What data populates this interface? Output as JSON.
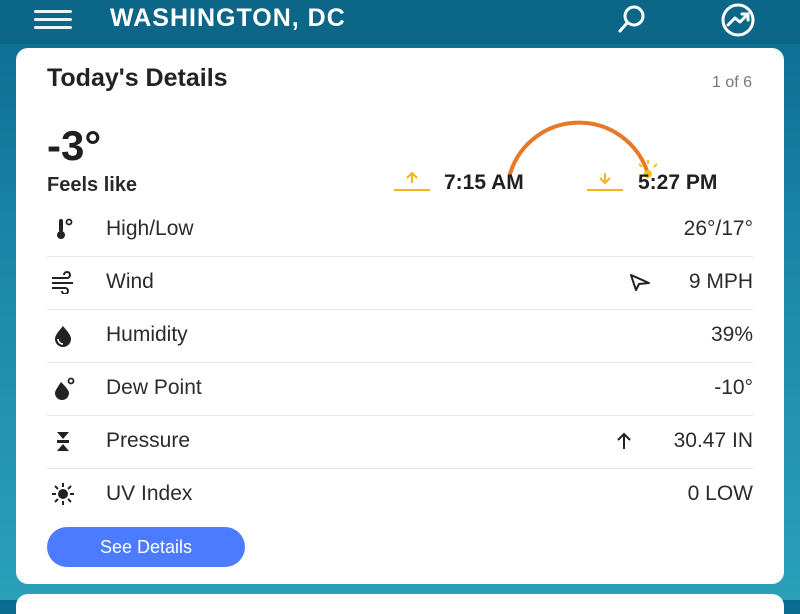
{
  "header": {
    "city": "WASHINGTON, DC",
    "icons": [
      "menu-icon",
      "search-icon",
      "trend-icon"
    ]
  },
  "card": {
    "title": "Today's Details",
    "pager": "1 of 6",
    "temperature": "-3°",
    "feels_label": "Feels like",
    "sunrise": "7:15 AM",
    "sunset": "5:27 PM",
    "rows": [
      {
        "label": "High/Low",
        "value": "26°/17°",
        "icon": "thermometer-icon"
      },
      {
        "label": "Wind",
        "value": "9 MPH",
        "icon": "wind-icon"
      },
      {
        "label": "Humidity",
        "value": "39%",
        "icon": "humidity-icon"
      },
      {
        "label": "Dew Point",
        "value": "-10°",
        "icon": "dewpoint-icon"
      },
      {
        "label": "Pressure",
        "value": "30.47 IN",
        "icon": "pressure-icon"
      },
      {
        "label": "UV Index",
        "value": "0 LOW",
        "icon": "uv-icon"
      }
    ],
    "button_label": "See Details"
  },
  "colors": {
    "header": "#0b6688",
    "sun_arc": "#e8782a",
    "sun_marker": "#f2c21a",
    "button": "#4c7bff"
  }
}
